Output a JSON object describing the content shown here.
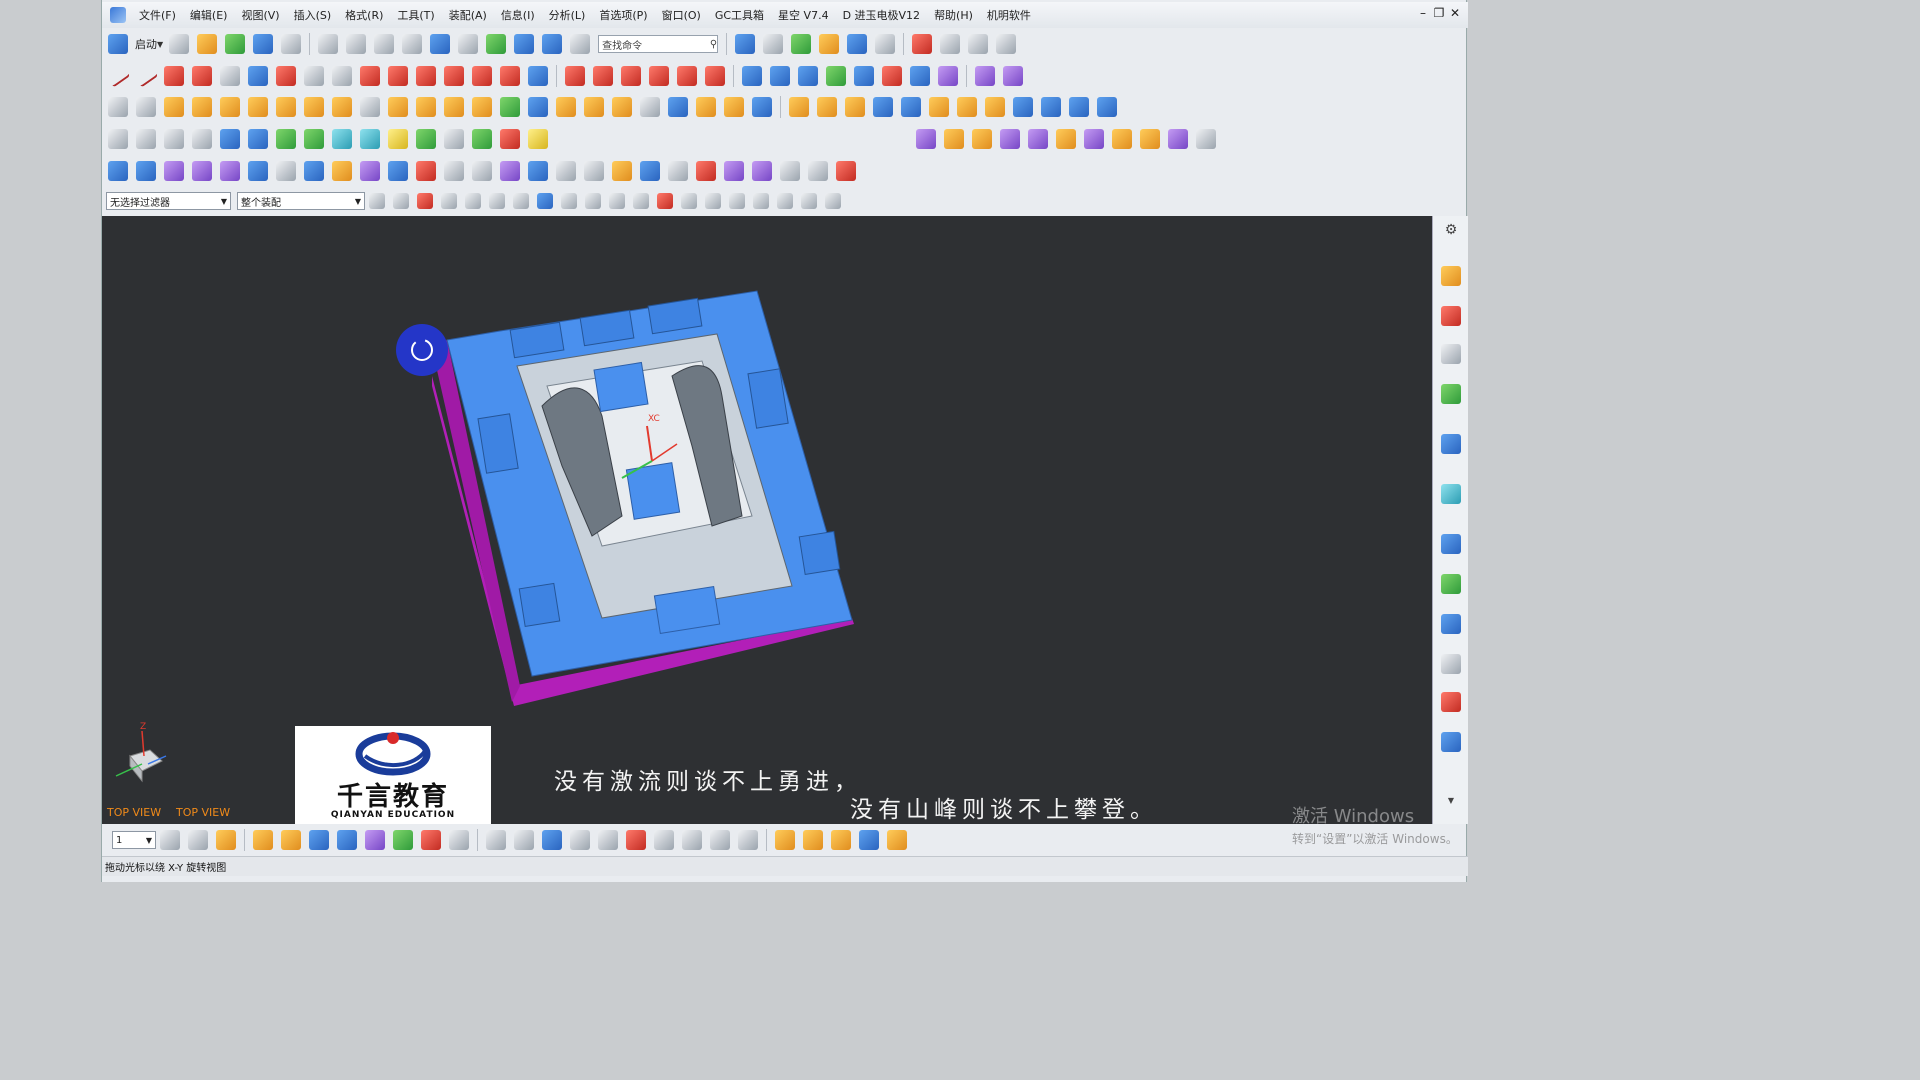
{
  "menu": [
    "文件(F)",
    "编辑(E)",
    "视图(V)",
    "插入(S)",
    "格式(R)",
    "工具(T)",
    "装配(A)",
    "信息(I)",
    "分析(L)",
    "首选项(P)",
    "窗口(O)",
    "GC工具箱",
    "星空 V7.4",
    "D 进玉电极V12",
    "帮助(H)",
    "机明软件"
  ],
  "window_controls": {
    "minimize": "–",
    "restore": "❐",
    "close": "✕"
  },
  "toolbar": {
    "start_label": "启动",
    "search_placeholder": "查找命令",
    "filter_select": "无选择过滤器",
    "scope_select": "整个装配",
    "layer_select": "1"
  },
  "viewport": {
    "view_label_1": "TOP VIEW",
    "view_label_2": "TOP VIEW",
    "logo_cn": "千言教育",
    "logo_en": "QIANYAN EDUCATION",
    "subtitle_line1": "没有激流则谈不上勇进，",
    "subtitle_line2": "没有山峰则谈不上攀登。",
    "watermark_line1": "激活 Windows",
    "watermark_line2": "转到“设置”以激活 Windows。",
    "axis_labels": {
      "xc": "XC",
      "z": "Z"
    }
  },
  "status": {
    "text": "拖动光标以绕 X-Y 旋转视图"
  },
  "colors": {
    "mold_top": "#4a90ee",
    "mold_side": "#b21fb8",
    "background": "#2e3033",
    "view_label": "#f08a1a"
  }
}
